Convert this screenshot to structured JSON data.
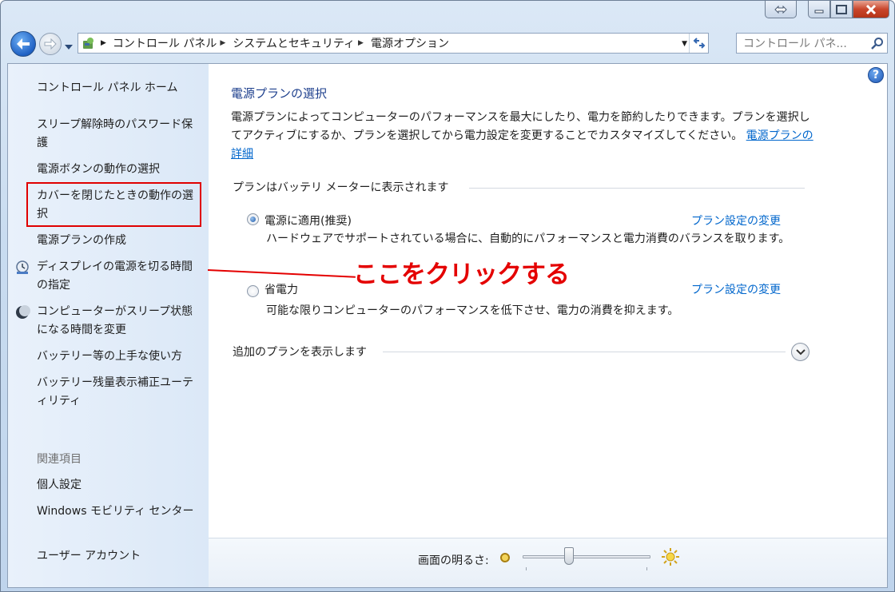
{
  "address": {
    "crumbs": [
      "コントロール パネル",
      "システムとセキュリティ",
      "電源オプション"
    ],
    "search_placeholder": "コントロール パネ..."
  },
  "sidebar": {
    "home": "コントロール パネル ホーム",
    "items": [
      "スリープ解除時のパスワード保護",
      "電源ボタンの動作の選択",
      "カバーを閉じたときの動作の選択",
      "電源プランの作成",
      "ディスプレイの電源を切る時間の指定",
      "コンピューターがスリープ状態になる時間を変更",
      "バッテリー等の上手な使い方",
      "バッテリー残量表示補正ユーティリティ"
    ],
    "related_heading": "関連項目",
    "related": [
      "個人設定",
      "Windows モビリティ センター",
      "ユーザー アカウント"
    ]
  },
  "main": {
    "title": "電源プランの選択",
    "description": "電源プランによってコンピューターのパフォーマンスを最大にしたり、電力を節約したりできます。プランを選択してアクティブにするか、プランを選択してから電力設定を変更することでカスタマイズしてください。",
    "details_link": "電源プランの詳細",
    "group_heading": "プランはバッテリ メーターに表示されます",
    "plans": [
      {
        "name": "電源に適用(推奨)",
        "change_link": "プラン設定の変更",
        "description": "ハードウェアでサポートされている場合に、自動的にパフォーマンスと電力消費のバランスを取ります。",
        "selected": true
      },
      {
        "name": "省電力",
        "change_link": "プラン設定の変更",
        "description": "可能な限りコンピューターのパフォーマンスを低下させ、電力の消費を抑えます。",
        "selected": false
      }
    ],
    "more_plans": "追加のプランを表示します"
  },
  "annotation": "ここをクリックする",
  "footer": {
    "brightness_label": "画面の明るさ:",
    "brightness_level": 0.36
  },
  "colors": {
    "annotation": "#e40000",
    "link": "#0066cc",
    "title": "#1d3f8d"
  }
}
